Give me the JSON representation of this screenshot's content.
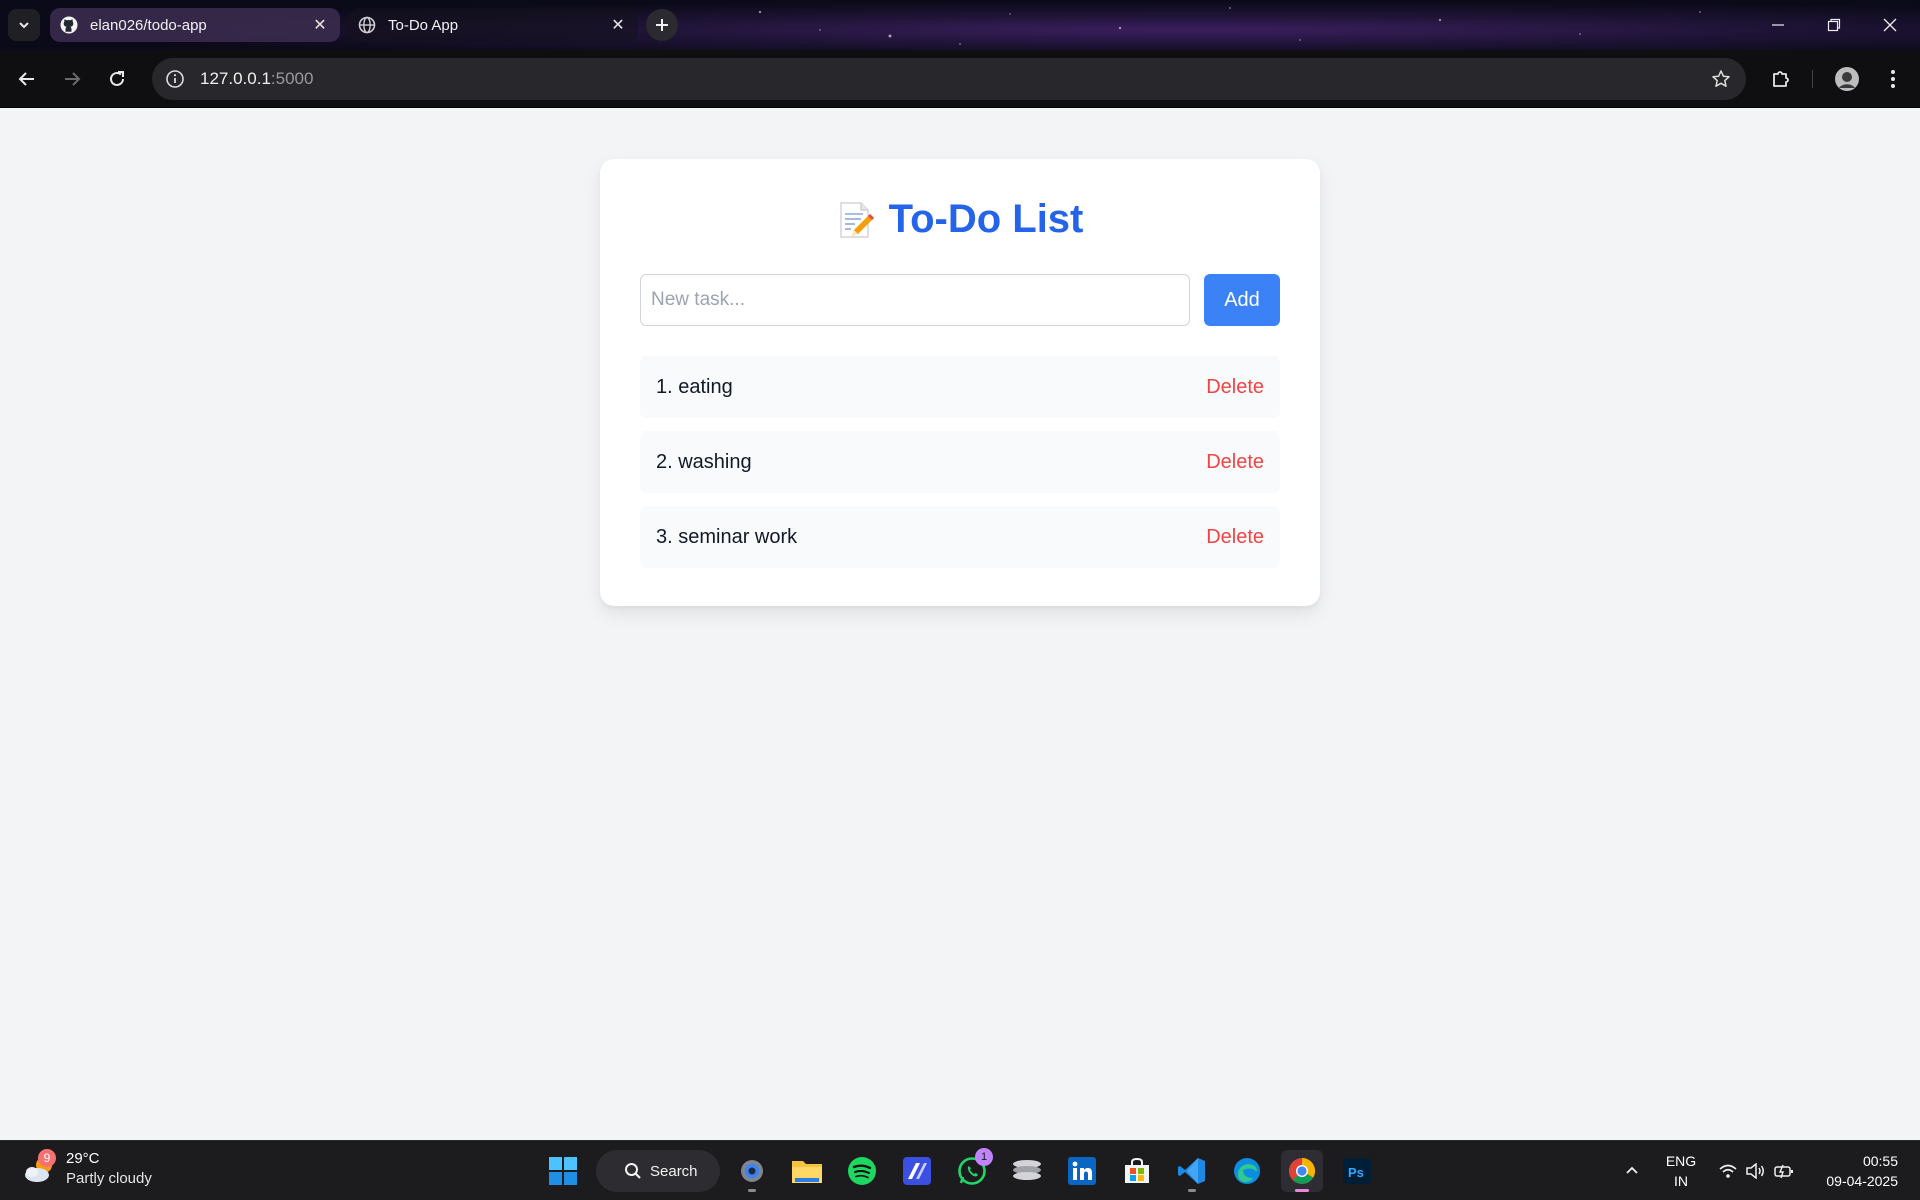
{
  "browser": {
    "tabs": [
      {
        "title": "elan026/todo-app",
        "icon": "github-icon",
        "active": false
      },
      {
        "title": "To-Do App",
        "icon": "globe-icon",
        "active": true
      }
    ],
    "url_host": "127.0.0.1",
    "url_port": ":5000"
  },
  "app": {
    "heading": "To-Do List",
    "heading_icon": "memo-icon",
    "heading_color": "#2563eb",
    "input_placeholder": "New task...",
    "input_value": "",
    "add_label": "Add",
    "add_color": "#3b82f6",
    "delete_color": "#ef4444",
    "tasks": [
      {
        "label": "1. eating",
        "delete_label": "Delete"
      },
      {
        "label": "2. washing",
        "delete_label": "Delete"
      },
      {
        "label": "3. seminar work",
        "delete_label": "Delete"
      }
    ]
  },
  "taskbar": {
    "weather": {
      "temp": "29°C",
      "condition": "Partly cloudy",
      "badge": "9"
    },
    "search_label": "Search",
    "apps": [
      "windows-start-icon",
      "settings-icon",
      "file-explorer-icon",
      "spotify-icon",
      "app-icon",
      "whatsapp-icon",
      "stack-app-icon",
      "linkedin-icon",
      "store-icon",
      "vscode-icon",
      "edge-icon",
      "chrome-icon",
      "photoshop-icon"
    ],
    "whatsapp_badge": "1",
    "language": {
      "line1": "ENG",
      "line2": "IN"
    },
    "time": "00:55",
    "date": "09-04-2025"
  }
}
